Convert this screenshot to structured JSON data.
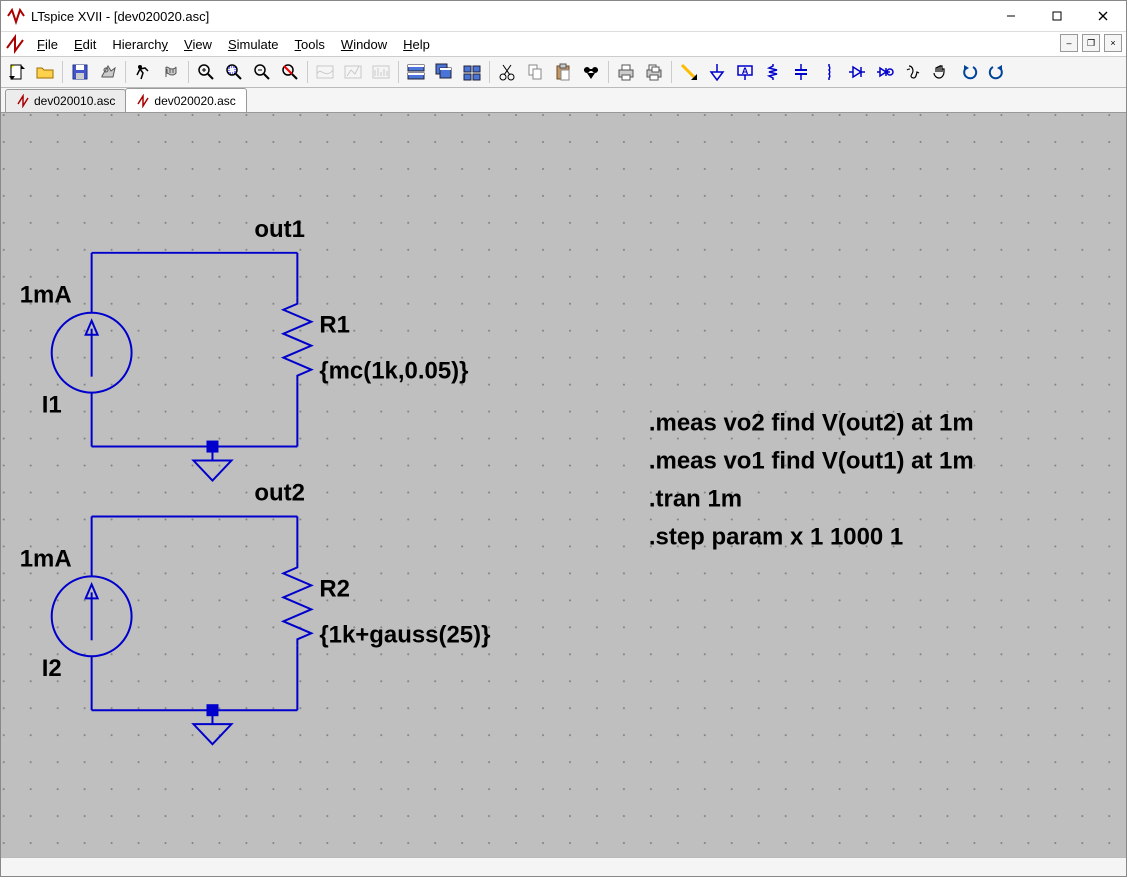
{
  "window": {
    "title": "LTspice XVII - [dev020020.asc]"
  },
  "menu": {
    "file": "File",
    "edit": "Edit",
    "hierarchy": "Hierarchy",
    "view": "View",
    "simulate": "Simulate",
    "tools": "Tools",
    "window": "Window",
    "help": "Help"
  },
  "tabs": [
    {
      "label": "dev020010.asc",
      "active": false
    },
    {
      "label": "dev020020.asc",
      "active": true
    }
  ],
  "schematic": {
    "circuit1": {
      "net_label": "out1",
      "source_value": "1mA",
      "source_name": "I1",
      "res_name": "R1",
      "res_value": "{mc(1k,0.05)}"
    },
    "circuit2": {
      "net_label": "out2",
      "source_value": "1mA",
      "source_name": "I2",
      "res_name": "R2",
      "res_value": "{1k+gauss(25)}"
    },
    "directives": {
      "d1": ".meas vo2 find V(out2) at 1m",
      "d2": ".meas vo1 find V(out1) at 1m",
      "d3": ".tran 1m",
      "d4": ".step param x 1 1000 1"
    }
  }
}
